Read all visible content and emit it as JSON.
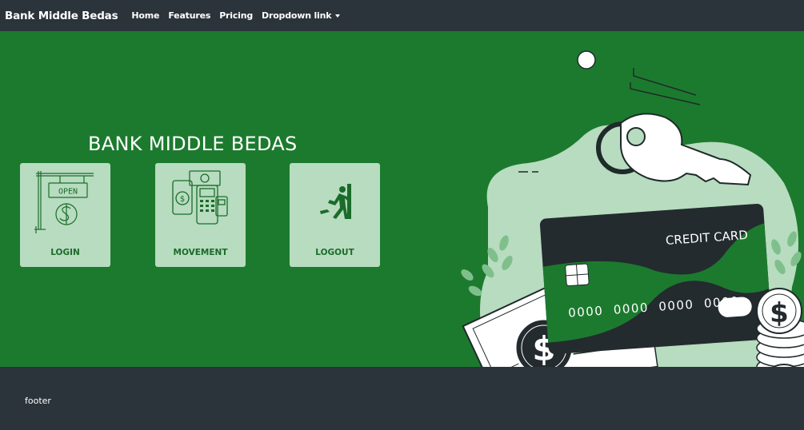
{
  "navbar": {
    "brand": "Bank Middle Bedas",
    "links": [
      "Home",
      "Features",
      "Pricing",
      "Dropdown link"
    ]
  },
  "hero": {
    "title": "BANK MIDDLE BEDAS",
    "cards": [
      {
        "label": "LOGIN",
        "icon": "open-sign-icon"
      },
      {
        "label": "MOVEMENT",
        "icon": "payment-terminal-icon"
      },
      {
        "label": "LOGOUT",
        "icon": "exit-door-icon"
      }
    ],
    "illustration": {
      "card_title": "CREDIT CARD",
      "card_number": "0000  0000  0000  0000",
      "sign_text": "OPEN"
    }
  },
  "footer": {
    "text": "footer"
  },
  "colors": {
    "navbar": "#2b333b",
    "hero": "#1c7a2e",
    "card_bg": "#b7dcbf",
    "card_text": "#1b6b2a"
  }
}
